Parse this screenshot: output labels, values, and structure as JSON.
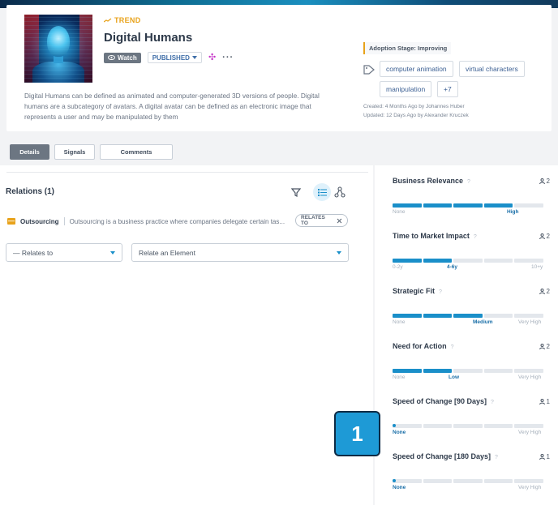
{
  "header": {
    "type_label": "TREND",
    "title": "Digital Humans",
    "watch_label": "Watch",
    "status_label": "PUBLISHED",
    "more_label": "···",
    "description": "Digital Humans can be defined as animated and computer-generated 3D versions of people. Digital humans are a subcategory of avatars. A digital avatar can be defined as an electronic image that represents a user and may be manipulated by them",
    "adoption_stage": "Adoption Stage: Improving",
    "tags": [
      "computer animation",
      "virtual characters",
      "manipulation",
      "+7"
    ],
    "created": "Created: 4 Months Ago by Johannes Huber",
    "updated": "Updated: 12 Days Ago by Alexander Kruczek"
  },
  "tabs": [
    {
      "label": "Details",
      "active": true
    },
    {
      "label": "Signals",
      "active": false
    },
    {
      "label": "Comments",
      "active": false
    }
  ],
  "relations": {
    "title": "Relations (1)",
    "items": [
      {
        "name": "Outsourcing",
        "description": "Outsourcing is a business practice where companies delegate certain tas...",
        "badge": "RELATES TO"
      }
    ],
    "relation_type_value": "— Relates to",
    "element_placeholder": "Relate an Element"
  },
  "metrics": [
    {
      "title": "Business Relevance",
      "count": "2",
      "scale": "5 segments",
      "filled": 4,
      "labels": [
        "None",
        "High"
      ],
      "active_label": "High"
    },
    {
      "title": "Time to Market Impact",
      "count": "2",
      "filled": 2,
      "labels": [
        "0-2y",
        "4-6y",
        "10+y"
      ],
      "active_label": "4-6y"
    },
    {
      "title": "Strategic Fit",
      "count": "2",
      "filled": 3,
      "labels": [
        "None",
        "Medium",
        "Very High"
      ],
      "active_label": "Medium"
    },
    {
      "title": "Need for Action",
      "count": "2",
      "filled": 2,
      "labels": [
        "None",
        "Low",
        "Very High"
      ],
      "active_label": "Low"
    },
    {
      "title": "Speed of Change [90 Days]",
      "count": "1",
      "filled": 0,
      "labels": [
        "None",
        "Very High"
      ],
      "active_label": "None"
    },
    {
      "title": "Speed of Change [180 Days]",
      "count": "1",
      "filled": 0,
      "labels": [
        "None",
        "Very High"
      ],
      "active_label": "None"
    }
  ],
  "callout": {
    "number": "1"
  },
  "colors": {
    "accent": "#1a8fc9",
    "trend": "#e8a21a",
    "watch": "#6c7682"
  }
}
